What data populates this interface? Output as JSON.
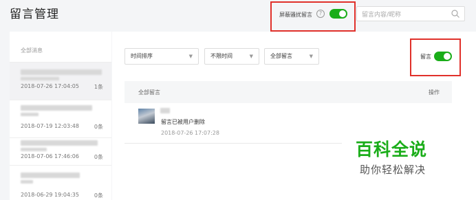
{
  "page": {
    "title": "留言管理"
  },
  "header": {
    "block_spam_label": "屏蔽骚扰留言",
    "help_icon": "question-circle-icon",
    "block_spam_enabled": true,
    "search_placeholder": "留言内容/昵称",
    "search_icon": "search-icon"
  },
  "sidebar": {
    "heading": "全部消息",
    "items": [
      {
        "date": "2018-07-26 17:04:05",
        "count": "1条",
        "active": true
      },
      {
        "date": "2018-07-19 12:03:48",
        "count": "0条",
        "active": false
      },
      {
        "date": "2018-07-06 17:46:06",
        "count": "0条",
        "active": false
      },
      {
        "date": "2018-06-29 19:04:35",
        "count": "0条",
        "active": false
      }
    ]
  },
  "filters": {
    "sort": "时间排序",
    "time": "不限时间",
    "scope": "全部留言",
    "comments_toggle_label": "留言",
    "comments_enabled": true
  },
  "table": {
    "header_left": "全部留言",
    "header_right": "操作"
  },
  "comment": {
    "text": "留言已被用户删除",
    "time": "2018-07-26 17:07:28"
  },
  "watermark": {
    "title": "百科全说",
    "subtitle": "助你轻松解决"
  },
  "colors": {
    "accent": "#1aad19",
    "highlight": "#e0302a"
  }
}
